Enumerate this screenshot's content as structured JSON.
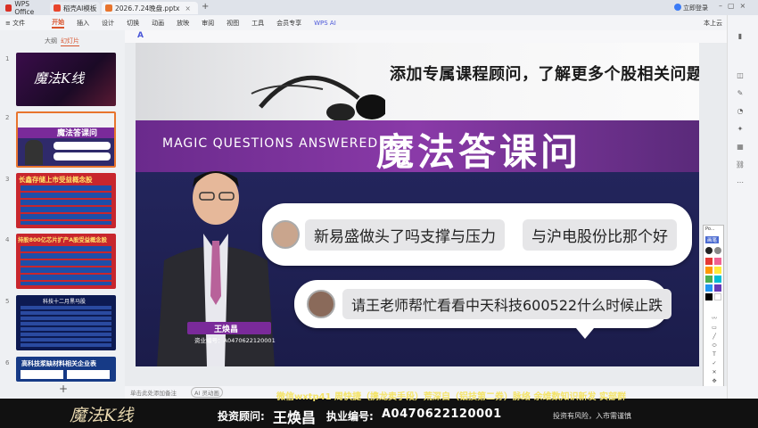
{
  "tabs": [
    {
      "label": "WPS Office",
      "color": "#d93025"
    },
    {
      "label": "稻壳AI模板",
      "color": "#e8462d"
    },
    {
      "label": "2026.7.24晚盘.pptx",
      "color": "#e8742d"
    }
  ],
  "window": {
    "login": "立即登录",
    "add_tab": "+"
  },
  "menu": {
    "file": "≡ 文件",
    "items": [
      "开始",
      "插入",
      "设计",
      "切换",
      "动画",
      "放映",
      "审阅",
      "视图",
      "工具",
      "会员专享",
      "WPS AI"
    ],
    "active_index": 0,
    "right": "⚲ ⌄",
    "share": "分享",
    "last_label": "本上云"
  },
  "left_panel": {
    "tabs": [
      "大纲",
      "幻灯片"
    ],
    "active_tab": 1,
    "slides": [
      {
        "num": "1",
        "title": "魔法K线"
      },
      {
        "num": "2",
        "title": "魔法答课问"
      },
      {
        "num": "3",
        "title": "长鑫存储上市受益概念股"
      },
      {
        "num": "4",
        "title": "持股800亿芯片扩产A股受益概念股"
      },
      {
        "num": "5",
        "title": "科技十二月黑马股"
      },
      {
        "num": "6",
        "title": "高科技浆缺材料相关企业表"
      }
    ],
    "add_slide": "+"
  },
  "slide": {
    "top_text": "添加专属课程顾问，了解更多个股相关问题",
    "en_title": "MAGIC QUESTIONS ANSWERED",
    "cn_title": "魔法答课问",
    "questions": [
      "新易盛做头了吗支撑与压力",
      "与沪电股份比那个好",
      "请王老师帮忙看看中天科技600522什么时候止跌"
    ],
    "presenter_name": "王焕昌",
    "presenter_cert": "资业编号：A0470622120001"
  },
  "status": {
    "notes": "单击此处添加备注",
    "ai": "AI 灵动画"
  },
  "palette": {
    "label_a": "Po...",
    "label_b": "画笔",
    "colors": [
      "#e53935",
      "#ff9800",
      "#ffeb3b",
      "#4caf50",
      "#2196f3",
      "#673ab7",
      "#000000",
      "#ffffff",
      "#9e9e9e",
      "#f06292"
    ]
  },
  "banner": {
    "logo": "魔法K线",
    "scroll": "微信wxtp41 周快捷（携龙卖手段）荒深自（铝技第二券）脉络 余维数知识新发 实部群",
    "advisor_label": "投资顾问:",
    "advisor_name": "王焕昌",
    "cert_label": "执业编号:",
    "cert_no": "A0470622120001",
    "risk": "投资有风险，入市需谨慎"
  }
}
